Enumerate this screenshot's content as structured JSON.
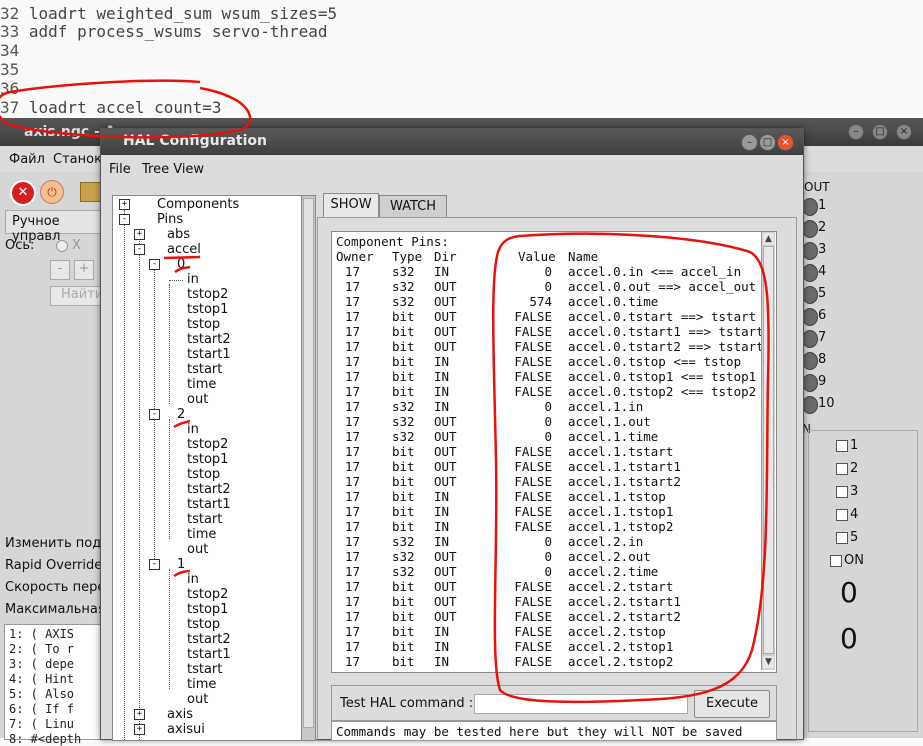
{
  "editor": {
    "lines": [
      {
        "num": "32",
        "text": " loadrt weighted_sum wsum_sizes=5"
      },
      {
        "num": "33",
        "text": " addf process_wsums servo-thread"
      },
      {
        "num": "34",
        "text": ""
      },
      {
        "num": "35",
        "text": ""
      },
      {
        "num": "36",
        "text": ""
      },
      {
        "num": "37",
        "text": " loadrt accel count=3"
      }
    ]
  },
  "axis": {
    "title": "axis.ngc - A",
    "menu": [
      "Файл",
      "Станок"
    ],
    "manual_tab": "Ручное управл",
    "axis_label": "Ось:",
    "axis_x": "X",
    "minus": "-",
    "plus": "+",
    "home_button": "Найти",
    "left_labels": [
      "Изменить пода",
      "Rapid Override:",
      "Скорость перем",
      "Максимальная"
    ],
    "gcode_lines": [
      "1: ( AXIS",
      "2: ( To r",
      "3: ( depe",
      "4: ( Hint",
      "5: ( Also",
      "6: ( If f",
      "7: ( Linu",
      "8: #<depth"
    ],
    "out_label": "OUT",
    "leds": [
      "1",
      "2",
      "3",
      "4",
      "5",
      "6",
      "7",
      "8",
      "9",
      "10"
    ],
    "in_label": "N",
    "checkboxes": [
      "1",
      "2",
      "3",
      "4",
      "5"
    ],
    "on_label": "ON",
    "big_values": [
      "0",
      "0"
    ]
  },
  "hal": {
    "title": "HAL Configuration",
    "menu": [
      "File",
      "Tree View"
    ],
    "tabs": {
      "show": "SHOW",
      "watch": "WATCH"
    },
    "tree": {
      "components": "Components",
      "pins": "Pins",
      "abs": "abs",
      "accel": "accel",
      "group0": "0",
      "group2": "2",
      "group1": "1",
      "leaves": [
        "in",
        "tstop2",
        "tstop1",
        "tstop",
        "tstart2",
        "tstart1",
        "tstart",
        "time",
        "out"
      ],
      "axis": "axis",
      "axisui": "axisui"
    },
    "pins_header": "Component Pins:",
    "columns": [
      "Owner",
      "Type",
      "Dir",
      "Value",
      "Name"
    ],
    "rows": [
      [
        "17",
        "s32",
        "IN",
        "0",
        "accel.0.in <== accel_in"
      ],
      [
        "17",
        "s32",
        "OUT",
        "0",
        "accel.0.out ==> accel_out"
      ],
      [
        "17",
        "s32",
        "OUT",
        "574",
        "accel.0.time"
      ],
      [
        "17",
        "bit",
        "OUT",
        "FALSE",
        "accel.0.tstart ==> tstart"
      ],
      [
        "17",
        "bit",
        "OUT",
        "FALSE",
        "accel.0.tstart1 ==> tstart1"
      ],
      [
        "17",
        "bit",
        "OUT",
        "FALSE",
        "accel.0.tstart2 ==> tstart2"
      ],
      [
        "17",
        "bit",
        "IN",
        "FALSE",
        "accel.0.tstop <== tstop"
      ],
      [
        "17",
        "bit",
        "IN",
        "FALSE",
        "accel.0.tstop1 <== tstop1"
      ],
      [
        "17",
        "bit",
        "IN",
        "FALSE",
        "accel.0.tstop2 <== tstop2"
      ],
      [
        "17",
        "s32",
        "IN",
        "0",
        "accel.1.in"
      ],
      [
        "17",
        "s32",
        "OUT",
        "0",
        "accel.1.out"
      ],
      [
        "17",
        "s32",
        "OUT",
        "0",
        "accel.1.time"
      ],
      [
        "17",
        "bit",
        "OUT",
        "FALSE",
        "accel.1.tstart"
      ],
      [
        "17",
        "bit",
        "OUT",
        "FALSE",
        "accel.1.tstart1"
      ],
      [
        "17",
        "bit",
        "OUT",
        "FALSE",
        "accel.1.tstart2"
      ],
      [
        "17",
        "bit",
        "IN",
        "FALSE",
        "accel.1.tstop"
      ],
      [
        "17",
        "bit",
        "IN",
        "FALSE",
        "accel.1.tstop1"
      ],
      [
        "17",
        "bit",
        "IN",
        "FALSE",
        "accel.1.tstop2"
      ],
      [
        "17",
        "s32",
        "IN",
        "0",
        "accel.2.in"
      ],
      [
        "17",
        "s32",
        "OUT",
        "0",
        "accel.2.out"
      ],
      [
        "17",
        "s32",
        "OUT",
        "0",
        "accel.2.time"
      ],
      [
        "17",
        "bit",
        "OUT",
        "FALSE",
        "accel.2.tstart"
      ],
      [
        "17",
        "bit",
        "OUT",
        "FALSE",
        "accel.2.tstart1"
      ],
      [
        "17",
        "bit",
        "OUT",
        "FALSE",
        "accel.2.tstart2"
      ],
      [
        "17",
        "bit",
        "IN",
        "FALSE",
        "accel.2.tstop"
      ],
      [
        "17",
        "bit",
        "IN",
        "FALSE",
        "accel.2.tstop1"
      ],
      [
        "17",
        "bit",
        "IN",
        "FALSE",
        "accel.2.tstop2"
      ]
    ],
    "test_label": "Test HAL command :",
    "test_value": "",
    "execute_label": "Execute",
    "message": "Commands may be tested here but they will NOT be saved"
  },
  "colors": {
    "annotation": "#e8120c",
    "close_button": "#e8542c",
    "stop_icon": "#d62020"
  }
}
